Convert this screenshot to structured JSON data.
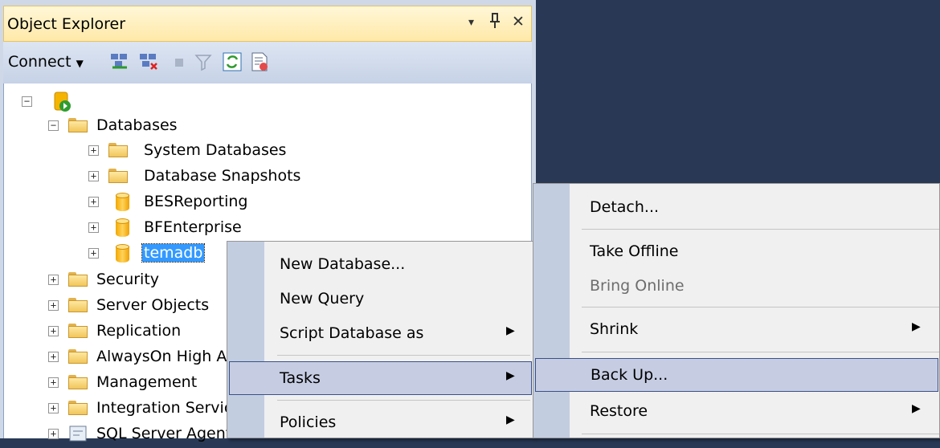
{
  "panel": {
    "title": "Object Explorer",
    "title_buttons": {
      "dropdown": "▾",
      "pin": "ᵖ",
      "close": "✕"
    },
    "toolbar": {
      "connect_label": "Connect",
      "icons": [
        "connect-object-explorer-icon",
        "disconnect-icon",
        "stop-icon",
        "filter-icon",
        "refresh-icon",
        "activity-monitor-icon"
      ]
    }
  },
  "tree": {
    "root_label": "",
    "databases_label": "Databases",
    "items": [
      "System Databases",
      "Database Snapshots",
      "BESReporting",
      "BFEnterprise",
      "temadb"
    ],
    "top_items": [
      "Security",
      "Server Objects",
      "Replication",
      "AlwaysOn High Availability",
      "Management",
      "Integration Services Catalogs",
      "SQL Server Agent"
    ]
  },
  "context_menu": {
    "items": [
      {
        "label": "New Database...",
        "submenu": false
      },
      {
        "label": "New Query",
        "submenu": false
      },
      {
        "label": "Script Database as",
        "submenu": true
      },
      {
        "label": "Tasks",
        "submenu": true
      },
      {
        "label": "Policies",
        "submenu": true
      }
    ]
  },
  "tasks_menu": {
    "items": [
      {
        "label": "Detach...",
        "submenu": false
      },
      {
        "label": "Take Offline",
        "submenu": false
      },
      {
        "label": "Bring Online",
        "submenu": false,
        "disabled": true
      },
      {
        "label": "Shrink",
        "submenu": true
      },
      {
        "label": "Back Up...",
        "submenu": false
      },
      {
        "label": "Restore",
        "submenu": true
      }
    ]
  },
  "colors": {
    "background": "#293955",
    "highlight": "#c6cde3",
    "selection": "#3399ff"
  }
}
